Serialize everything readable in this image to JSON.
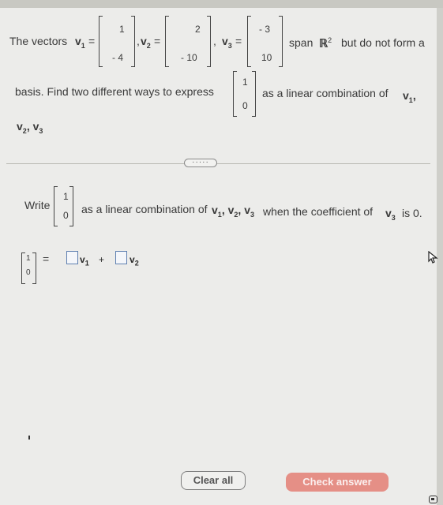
{
  "question": {
    "intro": "The vectors",
    "v1_label": "v",
    "v1_sub": "1",
    "v1": [
      "1",
      "- 4"
    ],
    "v2_label": "v",
    "v2_sub": "2",
    "v2": [
      "2",
      "- 10"
    ],
    "v3_label": "v",
    "v3_sub": "3",
    "v3": [
      "- 3",
      "10"
    ],
    "eq": "=",
    "comma": ",",
    "span_text": "span",
    "r_symbol": "ℝ",
    "r_sup": "2",
    "span_rest": "but do not form a",
    "line2_start": "basis. Find two different ways to express",
    "target": [
      "1",
      "0"
    ],
    "line2_end": "as a linear combination of",
    "line3": "v",
    "line3_sub2": "2",
    "line3_sub3": "3"
  },
  "more_button": "·····",
  "part": {
    "write": "Write",
    "target": [
      "1",
      "0"
    ],
    "desc_start": "as a linear combination of",
    "desc_end": "when the coefficient of",
    "desc_tail": "is 0.",
    "answer_eq": "=",
    "plus": "+",
    "v": "v",
    "sub1": "1",
    "sub2": "2",
    "sub3": "3"
  },
  "buttons": {
    "clear_all": "Clear all",
    "check_answer": "Check answer"
  }
}
